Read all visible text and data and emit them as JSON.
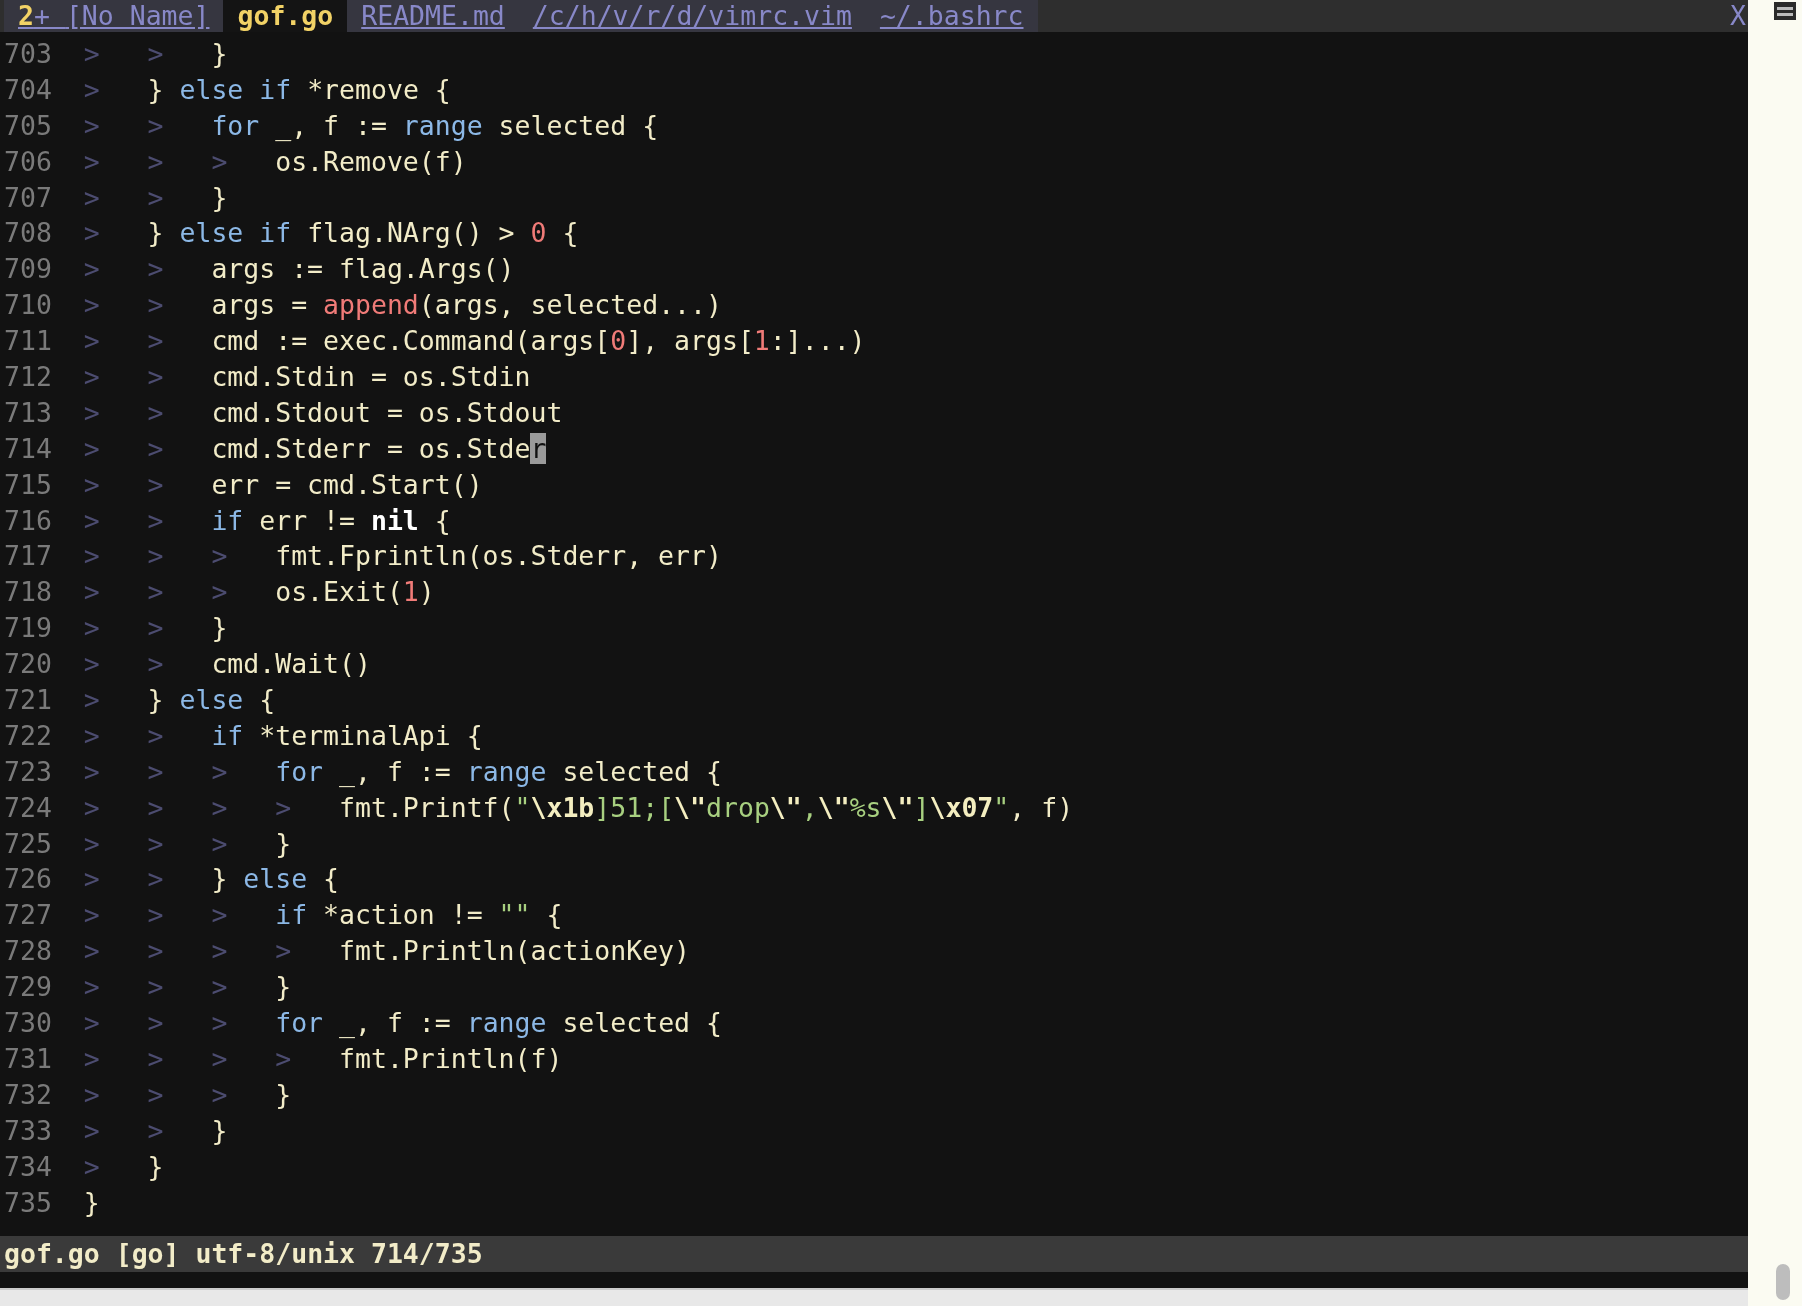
{
  "tabs": [
    {
      "count": "2",
      "flag": "+",
      "label": "[No Name]",
      "selected": false
    },
    {
      "label": "gof.go",
      "selected": true
    },
    {
      "label": "README.md",
      "selected": false
    },
    {
      "label": "/c/h/v/r/d/vimrc.vim",
      "selected": false
    },
    {
      "label": "~/.bashrc",
      "selected": false
    }
  ],
  "close_label": "X",
  "lines": [
    {
      "number": "703",
      "guides": [
        ">",
        ">"
      ],
      "tokens": [
        {
          "kind": "text",
          "text": "}"
        }
      ]
    },
    {
      "number": "704",
      "guides": [
        ">"
      ],
      "tokens": [
        {
          "kind": "text",
          "text": "} "
        },
        {
          "kind": "kw",
          "text": "else "
        },
        {
          "kind": "kw",
          "text": "if"
        },
        {
          "kind": "text",
          "text": " *remove {"
        }
      ]
    },
    {
      "number": "705",
      "guides": [
        ">",
        ">"
      ],
      "tokens": [
        {
          "kind": "kw",
          "text": "for"
        },
        {
          "kind": "text",
          "text": " _, f := "
        },
        {
          "kind": "kw",
          "text": "range"
        },
        {
          "kind": "text",
          "text": " selected {"
        }
      ]
    },
    {
      "number": "706",
      "guides": [
        ">",
        ">",
        ">"
      ],
      "tokens": [
        {
          "kind": "text",
          "text": "os.Remove(f)"
        }
      ]
    },
    {
      "number": "707",
      "guides": [
        ">",
        ">"
      ],
      "tokens": [
        {
          "kind": "text",
          "text": "}"
        }
      ]
    },
    {
      "number": "708",
      "guides": [
        ">"
      ],
      "tokens": [
        {
          "kind": "text",
          "text": "} "
        },
        {
          "kind": "kw",
          "text": "else "
        },
        {
          "kind": "kw",
          "text": "if"
        },
        {
          "kind": "text",
          "text": " flag.NArg() > "
        },
        {
          "kind": "num",
          "text": "0"
        },
        {
          "kind": "text",
          "text": " {"
        }
      ]
    },
    {
      "number": "709",
      "guides": [
        ">",
        ">"
      ],
      "tokens": [
        {
          "kind": "text",
          "text": "args := flag.Args()"
        }
      ]
    },
    {
      "number": "710",
      "guides": [
        ">",
        ">"
      ],
      "tokens": [
        {
          "kind": "text",
          "text": "args = "
        },
        {
          "kind": "builtin",
          "text": "append"
        },
        {
          "kind": "text",
          "text": "(args, selected...)"
        }
      ]
    },
    {
      "number": "711",
      "guides": [
        ">",
        ">"
      ],
      "tokens": [
        {
          "kind": "text",
          "text": "cmd := exec.Command(args["
        },
        {
          "kind": "num",
          "text": "0"
        },
        {
          "kind": "text",
          "text": "], args["
        },
        {
          "kind": "num",
          "text": "1"
        },
        {
          "kind": "text",
          "text": ":]...)"
        }
      ]
    },
    {
      "number": "712",
      "guides": [
        ">",
        ">"
      ],
      "tokens": [
        {
          "kind": "text",
          "text": "cmd.Stdin = os.Stdin"
        }
      ]
    },
    {
      "number": "713",
      "guides": [
        ">",
        ">"
      ],
      "tokens": [
        {
          "kind": "text",
          "text": "cmd.Stdout = os.Stdout"
        }
      ]
    },
    {
      "number": "714",
      "guides": [
        ">",
        ">"
      ],
      "tokens": [
        {
          "kind": "text",
          "text": "cmd.Stderr = os.Stde"
        },
        {
          "kind": "cursor",
          "text": "r"
        }
      ]
    },
    {
      "number": "715",
      "guides": [
        ">",
        ">"
      ],
      "tokens": [
        {
          "kind": "text",
          "text": "err = cmd.Start()"
        }
      ]
    },
    {
      "number": "716",
      "guides": [
        ">",
        ">"
      ],
      "tokens": [
        {
          "kind": "kw",
          "text": "if"
        },
        {
          "kind": "text",
          "text": " err != "
        },
        {
          "kind": "const",
          "text": "nil"
        },
        {
          "kind": "text",
          "text": " {"
        }
      ]
    },
    {
      "number": "717",
      "guides": [
        ">",
        ">",
        ">"
      ],
      "tokens": [
        {
          "kind": "text",
          "text": "fmt.Fprintln(os.Stderr, err)"
        }
      ]
    },
    {
      "number": "718",
      "guides": [
        ">",
        ">",
        ">"
      ],
      "tokens": [
        {
          "kind": "text",
          "text": "os.Exit("
        },
        {
          "kind": "num",
          "text": "1"
        },
        {
          "kind": "text",
          "text": ")"
        }
      ]
    },
    {
      "number": "719",
      "guides": [
        ">",
        ">"
      ],
      "tokens": [
        {
          "kind": "text",
          "text": "}"
        }
      ]
    },
    {
      "number": "720",
      "guides": [
        ">",
        ">"
      ],
      "tokens": [
        {
          "kind": "text",
          "text": "cmd.Wait()"
        }
      ]
    },
    {
      "number": "721",
      "guides": [
        ">"
      ],
      "tokens": [
        {
          "kind": "text",
          "text": "} "
        },
        {
          "kind": "kw",
          "text": "else"
        },
        {
          "kind": "text",
          "text": " {"
        }
      ]
    },
    {
      "number": "722",
      "guides": [
        ">",
        ">"
      ],
      "tokens": [
        {
          "kind": "kw",
          "text": "if"
        },
        {
          "kind": "text",
          "text": " *terminalApi {"
        }
      ]
    },
    {
      "number": "723",
      "guides": [
        ">",
        ">",
        ">"
      ],
      "tokens": [
        {
          "kind": "kw",
          "text": "for"
        },
        {
          "kind": "text",
          "text": " _, f := "
        },
        {
          "kind": "kw",
          "text": "range"
        },
        {
          "kind": "text",
          "text": " selected {"
        }
      ]
    },
    {
      "number": "724",
      "guides": [
        ">",
        ">",
        ">",
        ">"
      ],
      "tokens": [
        {
          "kind": "text",
          "text": "fmt.Printf("
        },
        {
          "kind": "str",
          "text": "\""
        },
        {
          "kind": "esc",
          "text": "\\x1b"
        },
        {
          "kind": "str",
          "text": "]51;["
        },
        {
          "kind": "esc",
          "text": "\\\""
        },
        {
          "kind": "str",
          "text": "drop"
        },
        {
          "kind": "esc",
          "text": "\\\""
        },
        {
          "kind": "str",
          "text": ","
        },
        {
          "kind": "esc",
          "text": "\\\""
        },
        {
          "kind": "str",
          "text": "%s"
        },
        {
          "kind": "esc",
          "text": "\\\""
        },
        {
          "kind": "str",
          "text": "]"
        },
        {
          "kind": "esc",
          "text": "\\x07"
        },
        {
          "kind": "str",
          "text": "\""
        },
        {
          "kind": "text",
          "text": ", f)"
        }
      ]
    },
    {
      "number": "725",
      "guides": [
        ">",
        ">",
        ">"
      ],
      "tokens": [
        {
          "kind": "text",
          "text": "}"
        }
      ]
    },
    {
      "number": "726",
      "guides": [
        ">",
        ">"
      ],
      "tokens": [
        {
          "kind": "text",
          "text": "} "
        },
        {
          "kind": "kw",
          "text": "else"
        },
        {
          "kind": "text",
          "text": " {"
        }
      ]
    },
    {
      "number": "727",
      "guides": [
        ">",
        ">",
        ">"
      ],
      "tokens": [
        {
          "kind": "kw",
          "text": "if"
        },
        {
          "kind": "text",
          "text": " *action != "
        },
        {
          "kind": "str",
          "text": "\"\""
        },
        {
          "kind": "text",
          "text": " {"
        }
      ]
    },
    {
      "number": "728",
      "guides": [
        ">",
        ">",
        ">",
        ">"
      ],
      "tokens": [
        {
          "kind": "text",
          "text": "fmt.Println(actionKey)"
        }
      ]
    },
    {
      "number": "729",
      "guides": [
        ">",
        ">",
        ">"
      ],
      "tokens": [
        {
          "kind": "text",
          "text": "}"
        }
      ]
    },
    {
      "number": "730",
      "guides": [
        ">",
        ">",
        ">"
      ],
      "tokens": [
        {
          "kind": "kw",
          "text": "for"
        },
        {
          "kind": "text",
          "text": " _, f := "
        },
        {
          "kind": "kw",
          "text": "range"
        },
        {
          "kind": "text",
          "text": " selected {"
        }
      ]
    },
    {
      "number": "731",
      "guides": [
        ">",
        ">",
        ">",
        ">"
      ],
      "tokens": [
        {
          "kind": "text",
          "text": "fmt.Println(f)"
        }
      ]
    },
    {
      "number": "732",
      "guides": [
        ">",
        ">",
        ">"
      ],
      "tokens": [
        {
          "kind": "text",
          "text": "}"
        }
      ]
    },
    {
      "number": "733",
      "guides": [
        ">",
        ">"
      ],
      "tokens": [
        {
          "kind": "text",
          "text": "}"
        }
      ]
    },
    {
      "number": "734",
      "guides": [
        ">"
      ],
      "tokens": [
        {
          "kind": "text",
          "text": "}"
        }
      ]
    },
    {
      "number": "735",
      "tokens": [
        {
          "kind": "text",
          "text": "}"
        }
      ]
    }
  ],
  "status_line": "gof.go [go] utf-8/unix 714/735"
}
